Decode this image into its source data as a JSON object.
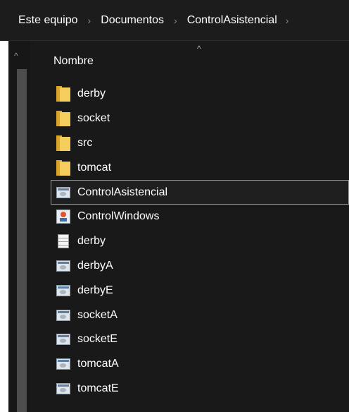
{
  "breadcrumb": {
    "items": [
      "Este equipo",
      "Documentos",
      "ControlAsistencial"
    ],
    "separator": "›"
  },
  "header": {
    "column_label": "Nombre",
    "sort_indicator": "^"
  },
  "scrollbar": {
    "up_arrow": "^"
  },
  "files": [
    {
      "name": "derby",
      "icon": "folder-icon"
    },
    {
      "name": "socket",
      "icon": "folder-icon"
    },
    {
      "name": "src",
      "icon": "folder-icon"
    },
    {
      "name": "tomcat",
      "icon": "folder-icon"
    },
    {
      "name": "ControlAsistencial",
      "icon": "exe-icon",
      "selected": true
    },
    {
      "name": "ControlWindows",
      "icon": "jar-icon"
    },
    {
      "name": "derby",
      "icon": "file-icon"
    },
    {
      "name": "derbyA",
      "icon": "exe-icon"
    },
    {
      "name": "derbyE",
      "icon": "exe-icon"
    },
    {
      "name": "socketA",
      "icon": "exe-icon"
    },
    {
      "name": "socketE",
      "icon": "exe-icon"
    },
    {
      "name": "tomcatA",
      "icon": "exe-icon"
    },
    {
      "name": "tomcatE",
      "icon": "exe-icon"
    }
  ],
  "colors": {
    "background": "#191919",
    "folder": "#f5cd5c",
    "selection_border": "#9a9a9a"
  }
}
